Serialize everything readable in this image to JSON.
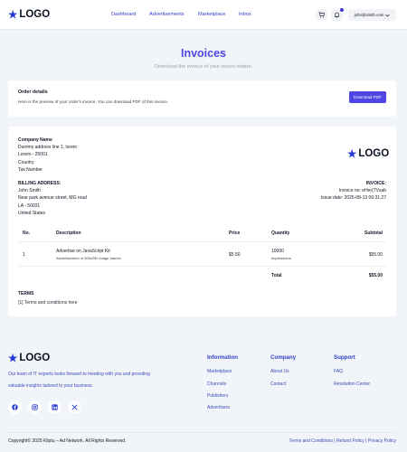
{
  "header": {
    "logo_text": "LOGO",
    "nav": [
      "Dashboard",
      "Advertisements",
      "Marketplace",
      "Inbox"
    ],
    "user_email": "john@smith.com",
    "icons": [
      "cart-icon",
      "bell-icon",
      "chevron-down-icon"
    ]
  },
  "page": {
    "title": "Invoices",
    "subtitle": "Download the invoice of your recent orders."
  },
  "order_details": {
    "title": "Order details",
    "description": "Here is the preview of your order's invoice. You can download PDF of this invoice.",
    "download_label": "Download PDF"
  },
  "invoice": {
    "company": {
      "name": "Company Name",
      "address1": "Dummy address line 1, lorem",
      "address2": "Lorem - 25001",
      "country": "Country",
      "tax": "Tax Number"
    },
    "billing": {
      "heading": "BILLING ADDRESS:",
      "name": "John Smith",
      "street": "Near park avenue street, MG road",
      "city": "LA - 50031",
      "country": "United States"
    },
    "meta": {
      "heading": "INVOICE:",
      "number": "Invoice no: eHer{7Vsab",
      "date": "Issue date: 2025-08-13 06:31:27"
    },
    "columns": [
      "No.",
      "Description",
      "Price",
      "Quantity",
      "Subtotal"
    ],
    "items": [
      {
        "no": "1",
        "title": "Advertise on JavaScript Kit",
        "subtitle": "Advertisement of 300x250 image banner",
        "price": "$5.50",
        "quantity": "10000",
        "quantity_unit": "Impressions",
        "subtotal": "$55.00"
      }
    ],
    "total_label": "Total",
    "total_value": "$55.00",
    "terms_title": "TERMS",
    "terms_text": "[1] Terms and conditions here"
  },
  "footer": {
    "tagline": "Our team of IT experts looks forward to meeting with you and providing valuable insights tailored to your business.",
    "social": [
      "facebook-icon",
      "instagram-icon",
      "linkedin-icon",
      "x-icon"
    ],
    "columns": [
      {
        "title": "Information",
        "links": [
          "Marketplace",
          "Channels",
          "Publishers",
          "Advertisers"
        ]
      },
      {
        "title": "Company",
        "links": [
          "About Us",
          "Contact"
        ]
      },
      {
        "title": "Support",
        "links": [
          "FAQ",
          "Resolution Center"
        ]
      }
    ],
    "copyright": "Copyright© 2025 Kliptu – Ad Network. All Rights Reserved.",
    "legal_links": [
      "Terms and Conditions",
      "Refund Policy",
      "Privacy Policy"
    ]
  },
  "colors": {
    "accent": "#4f46e5",
    "brand_blue": "#2438d6",
    "background": "#f1f4f8"
  }
}
